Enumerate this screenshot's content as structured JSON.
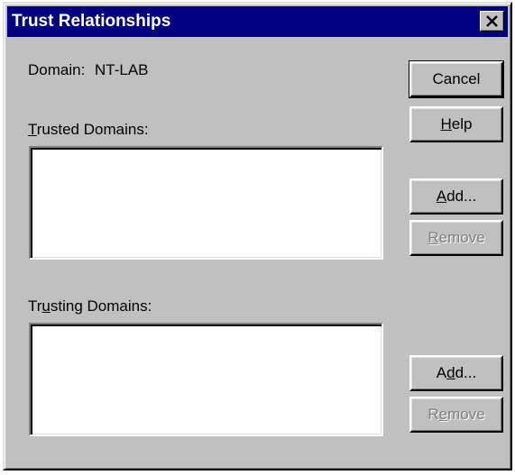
{
  "dialog": {
    "title": "Trust Relationships",
    "close_glyph": "✕"
  },
  "domain": {
    "label": "Domain:",
    "value": "NT-LAB"
  },
  "trusted": {
    "label_pre": "",
    "label_mnemonic": "T",
    "label_post": "rusted Domains:",
    "items": []
  },
  "trusting": {
    "label_pre": "Tr",
    "label_mnemonic": "u",
    "label_post": "sting Domains:",
    "items": []
  },
  "buttons": {
    "cancel": {
      "label": "Cancel",
      "enabled": true
    },
    "help": {
      "pre": "",
      "mn": "H",
      "post": "elp",
      "enabled": true
    },
    "trusted_add": {
      "pre": "",
      "mn": "A",
      "post": "dd...",
      "enabled": true
    },
    "trusted_remove": {
      "pre": "",
      "mn": "R",
      "post": "emove",
      "enabled": false
    },
    "trusting_add": {
      "pre": "A",
      "mn": "d",
      "post": "d...",
      "enabled": true
    },
    "trusting_remove": {
      "pre": "R",
      "mn": "e",
      "post": "move",
      "enabled": false
    }
  },
  "colors": {
    "face": "#c0c0c0",
    "titlebar": "#000080",
    "disabled_text": "#808080"
  }
}
